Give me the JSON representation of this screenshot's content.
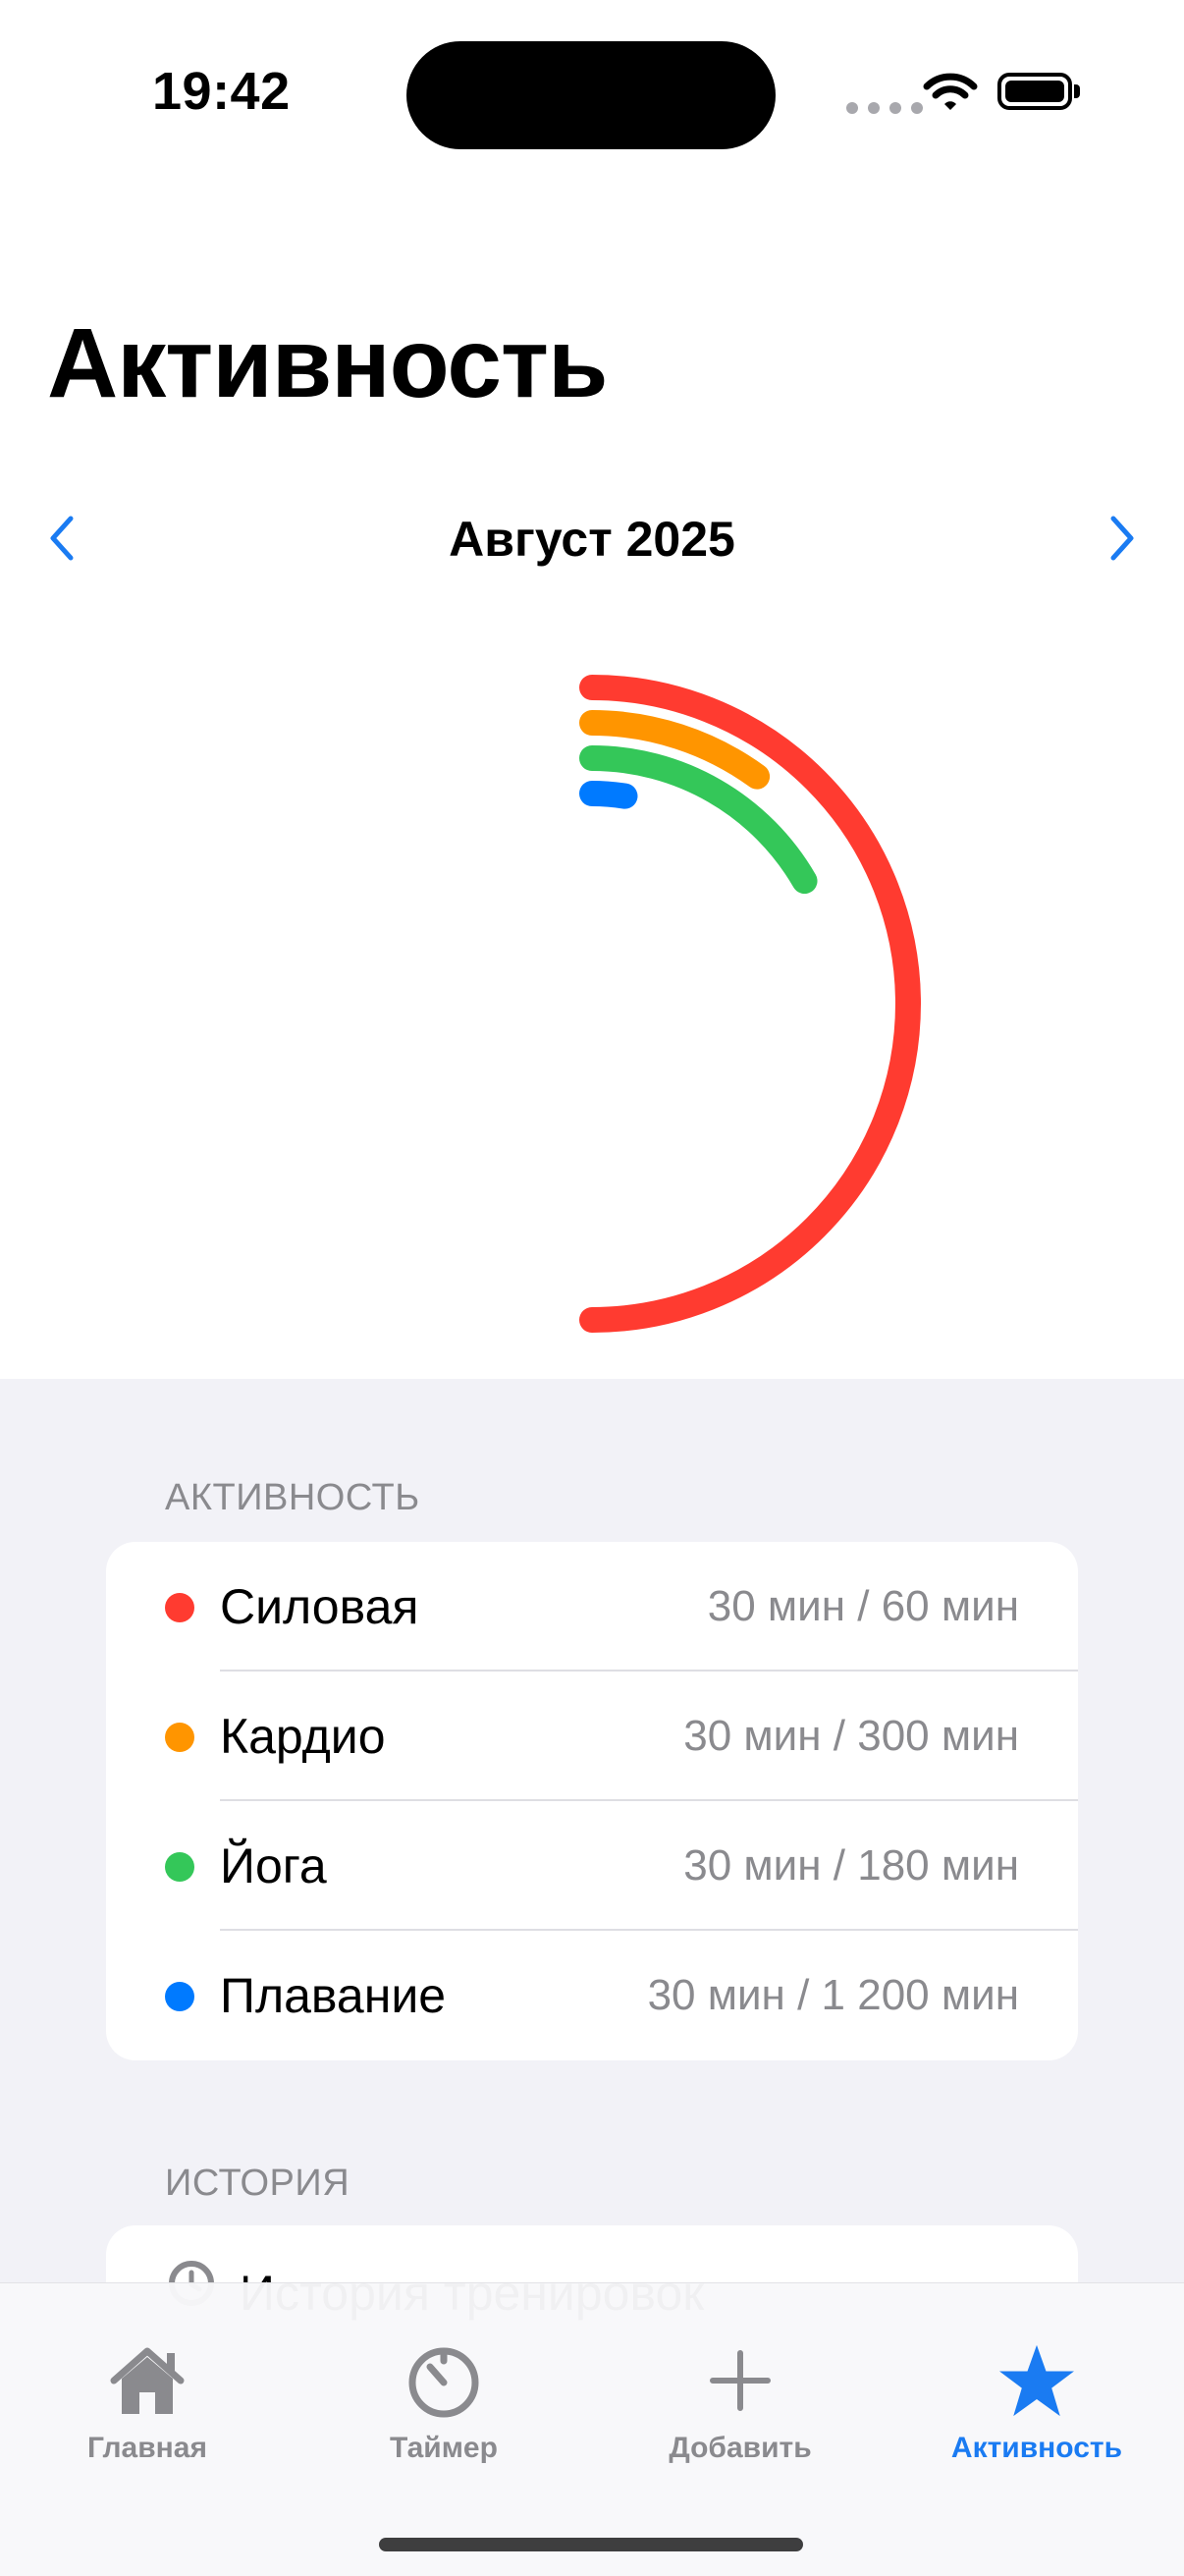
{
  "status_bar": {
    "time": "19:42"
  },
  "page_title": "Активность",
  "month_nav": {
    "label": "Август 2025"
  },
  "activity_section": {
    "header": "АКТИВНОСТЬ",
    "items": [
      {
        "name": "Силовая",
        "value": "30 мин / 60 мин",
        "color": "#ff3b30",
        "progress": 0.5
      },
      {
        "name": "Кардио",
        "value": "30 мин / 300 мин",
        "color": "#ff9500",
        "progress": 0.1
      },
      {
        "name": "Йога",
        "value": "30 мин / 180 мин",
        "color": "#34c759",
        "progress": 0.1667
      },
      {
        "name": "Плавание",
        "value": "30 мин / 1 200 мин",
        "color": "#007aff",
        "progress": 0.025
      }
    ]
  },
  "history_section": {
    "header": "ИСТОРИЯ",
    "item_label": "История тренировок"
  },
  "tab_bar": {
    "tabs": [
      {
        "label": "Главная",
        "icon": "house-icon",
        "active": false
      },
      {
        "label": "Таймер",
        "icon": "timer-icon",
        "active": false
      },
      {
        "label": "Добавить",
        "icon": "plus-icon",
        "active": false
      },
      {
        "label": "Активность",
        "icon": "star-icon",
        "active": true
      }
    ]
  },
  "colors": {
    "accent": "#1a7bf2",
    "inactive": "#8a8a8e"
  }
}
